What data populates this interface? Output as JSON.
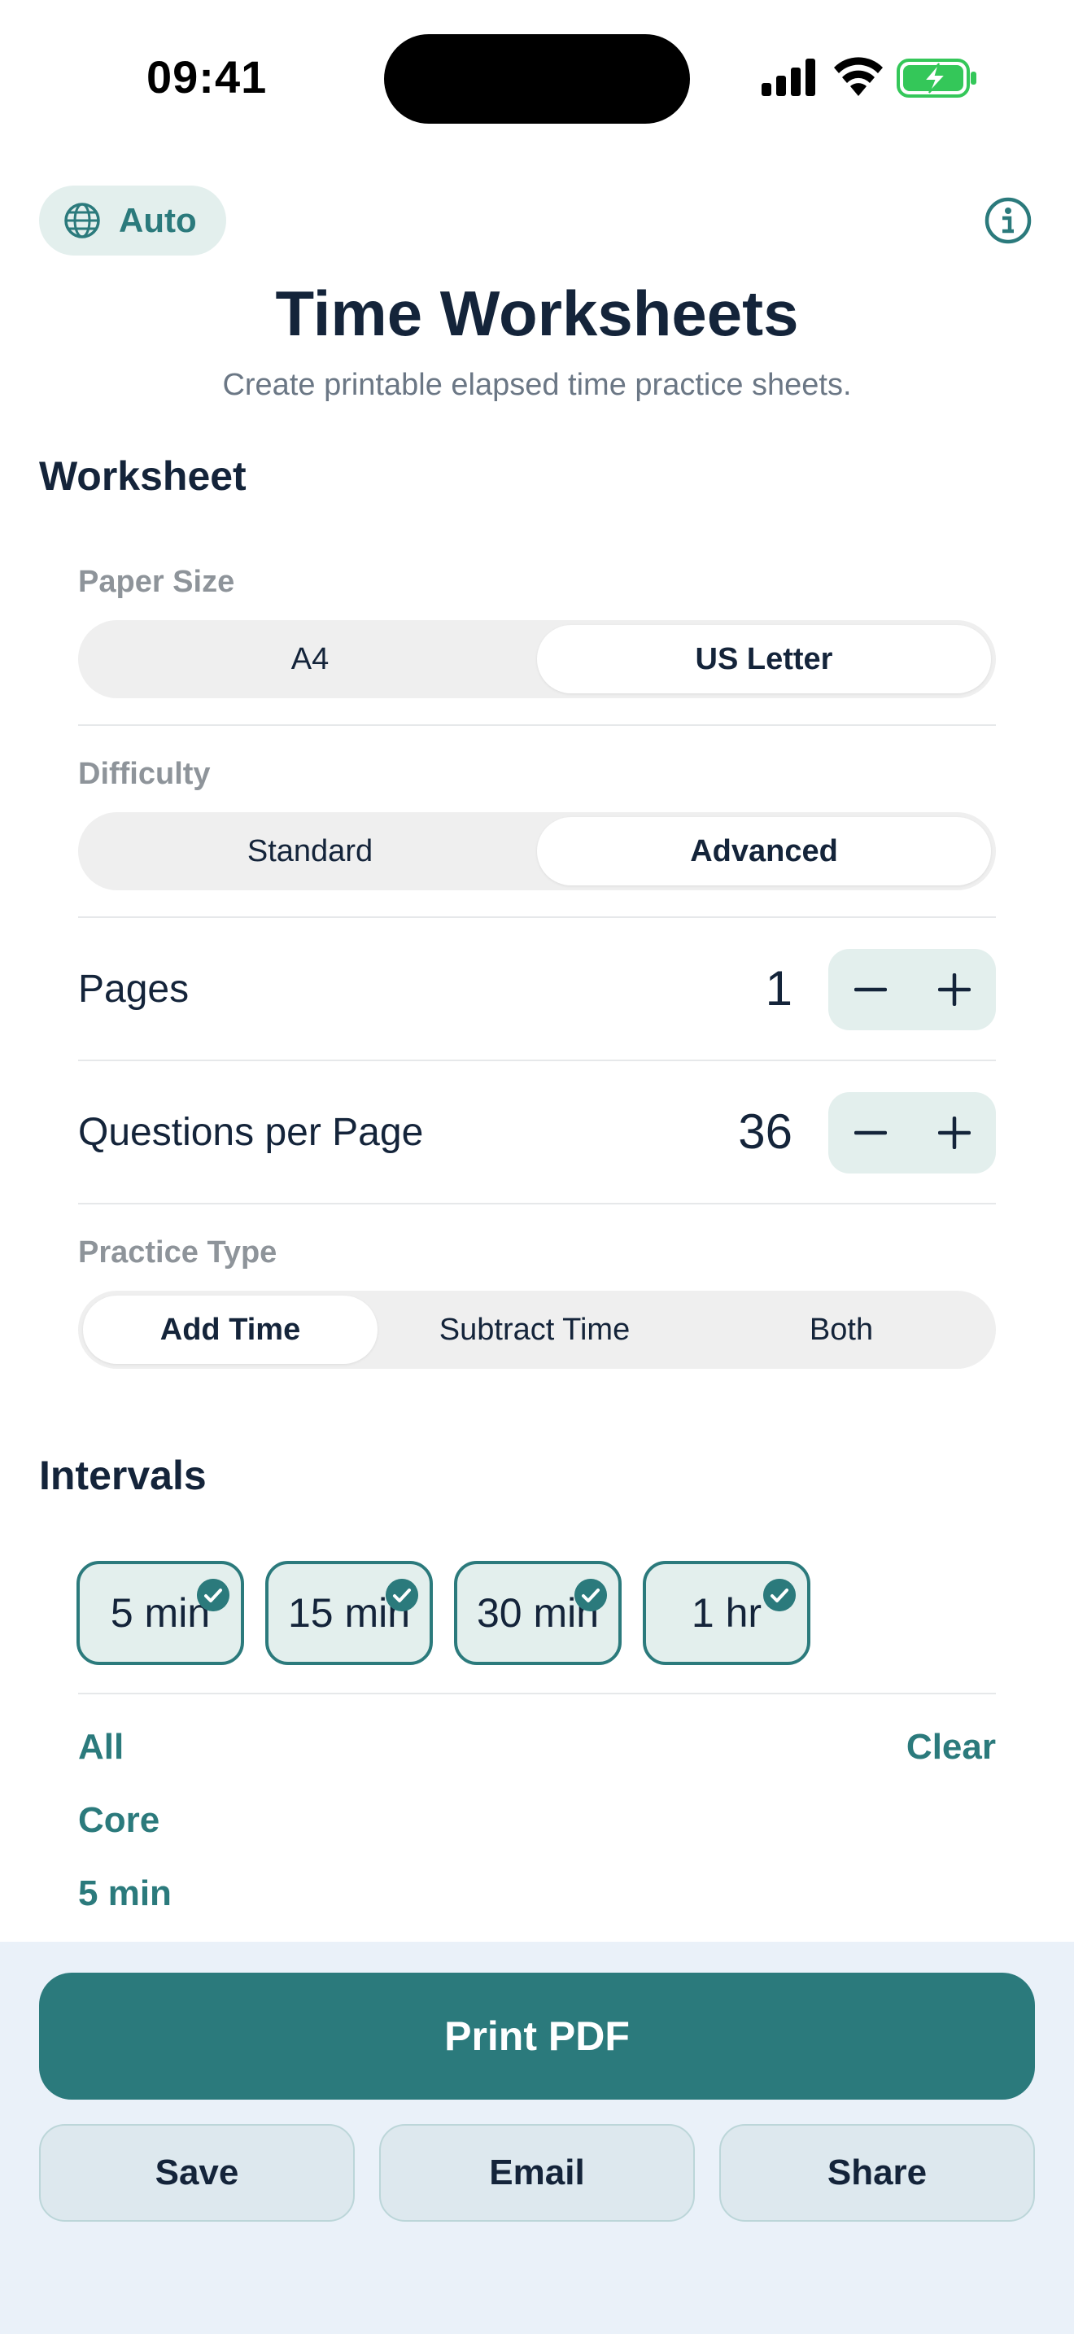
{
  "status_bar": {
    "time": "09:41"
  },
  "header": {
    "language_label": "Auto",
    "title": "Time Worksheets",
    "subtitle": "Create printable elapsed time practice sheets."
  },
  "worksheet": {
    "heading": "Worksheet",
    "paper_size": {
      "label": "Paper Size",
      "options": [
        "A4",
        "US Letter"
      ],
      "selected": "US Letter"
    },
    "difficulty": {
      "label": "Difficulty",
      "options": [
        "Standard",
        "Advanced"
      ],
      "selected": "Advanced"
    },
    "pages": {
      "label": "Pages",
      "value": "1"
    },
    "questions_per_page": {
      "label": "Questions per Page",
      "value": "36"
    },
    "practice_type": {
      "label": "Practice Type",
      "options": [
        "Add Time",
        "Subtract Time",
        "Both"
      ],
      "selected": "Add Time"
    },
    "stepper_minus": "−",
    "stepper_plus": "+"
  },
  "intervals": {
    "heading": "Intervals",
    "chips": [
      {
        "label": "5 min",
        "checked": true
      },
      {
        "label": "15 min",
        "checked": true
      },
      {
        "label": "30 min",
        "checked": true
      },
      {
        "label": "1 hr",
        "checked": true
      }
    ],
    "all_label": "All",
    "clear_label": "Clear",
    "presets": [
      "Core",
      "5 min"
    ]
  },
  "actions": {
    "print": "Print PDF",
    "save": "Save",
    "email": "Email",
    "share": "Share"
  },
  "colors": {
    "accent": "#2b7a7c",
    "accent_light": "#e3efed",
    "text": "#14243a",
    "muted": "#8e949a",
    "panel": "#eaf1f9",
    "battery": "#34c759"
  }
}
